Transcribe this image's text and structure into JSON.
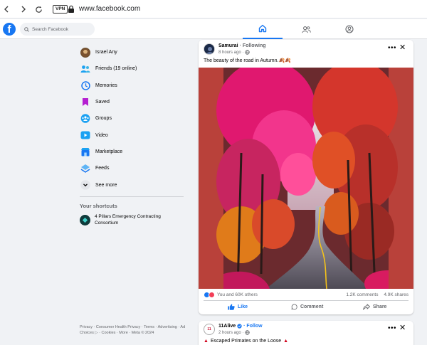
{
  "browser": {
    "url": "www.facebook.com",
    "vpn_label": "VPN"
  },
  "header": {
    "logo_letter": "f",
    "search_placeholder": "Search Facebook",
    "tabs": [
      {
        "name": "home-icon",
        "active": true
      },
      {
        "name": "groups-icon",
        "active": false
      },
      {
        "name": "profile-icon",
        "active": false
      }
    ]
  },
  "sidebar": {
    "items": [
      {
        "label": "Israel Any",
        "icon": "avatar"
      },
      {
        "label": "Friends (19 online)",
        "icon": "friends-icon"
      },
      {
        "label": "Memories",
        "icon": "memories-icon"
      },
      {
        "label": "Saved",
        "icon": "saved-icon"
      },
      {
        "label": "Groups",
        "icon": "groups-icon"
      },
      {
        "label": "Video",
        "icon": "video-icon"
      },
      {
        "label": "Marketplace",
        "icon": "marketplace-icon"
      },
      {
        "label": "Feeds",
        "icon": "feeds-icon"
      },
      {
        "label": "See more",
        "icon": "chevron-down-icon"
      }
    ],
    "shortcuts_title": "Your shortcuts",
    "shortcuts": [
      {
        "label": "4 Pillars Emergency Contracting Consortium"
      }
    ],
    "footer": "Privacy · Consumer Health Privacy · Terms · Advertising · Ad Choices ▷ · Cookies · More · Meta © 2024"
  },
  "post": {
    "author": "Samurai",
    "follow": "· Following",
    "time": "8 hours ago ·",
    "text": "The beauty of the road in Autumn.🍂🍂",
    "reactions_text": "You and 60K others",
    "comments": "1.2K comments",
    "shares": "4.9K shares",
    "like_label": "Like",
    "comment_label": "Comment",
    "share_label": "Share"
  },
  "post2": {
    "author": "11Alive",
    "follow": "· Follow",
    "time": "2 hours ago ·",
    "text": "Escaped Primates on the Loose",
    "avatar_text": "11"
  },
  "colors": {
    "accent": "#1877f2",
    "image_bg": "#b9413a"
  }
}
